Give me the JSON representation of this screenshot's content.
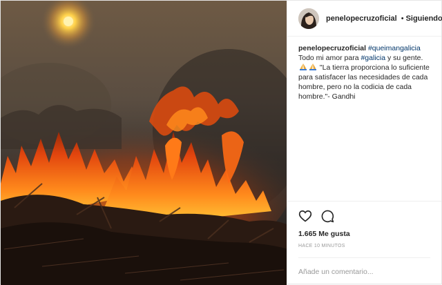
{
  "post": {
    "username": "penelopecruzoficial",
    "follow_status": "Siguiendo",
    "separator": "•",
    "caption": {
      "username": "penelopecruzoficial",
      "hashtag1": "#queimangalicia",
      "text1": " Todo mi amor para ",
      "hashtag2": "#galicia",
      "text2": " y su gente.",
      "text3": " \"La tierra proporciona lo suficiente para satisfacer las necesidades de cada hombre, pero no la codicia de cada hombre.\"- Gandhi"
    },
    "likes": "1.665 Me gusta",
    "timestamp": "HACE 10 MINUTOS",
    "comment_placeholder": "Añade un comentario...",
    "icons": {
      "like": "heart-icon",
      "comment": "comment-icon",
      "verified": "verified-badge-icon",
      "emoji": "praying-hands-emoji"
    },
    "colors": {
      "link": "#003569",
      "verified": "#3897f0",
      "muted": "#999999"
    }
  }
}
